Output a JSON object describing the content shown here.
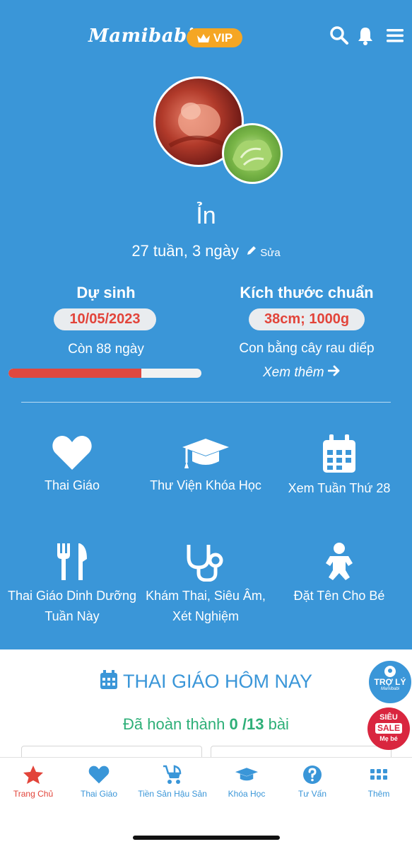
{
  "header": {
    "brand": "Mamibabi",
    "vip_label": "VIP"
  },
  "profile": {
    "name": "Ỉn",
    "gestational_age": "27 tuần, 3 ngày",
    "edit_label": "Sửa"
  },
  "due": {
    "title": "Dự sinh",
    "date": "10/05/2023",
    "remaining": "Còn 88 ngày",
    "progress": 0.69
  },
  "size": {
    "title": "Kích thước chuẩn",
    "value": "38cm; 1000g",
    "compare": "Con bằng cây rau diếp",
    "more": "Xem thêm"
  },
  "features": [
    {
      "label": "Thai Giáo",
      "icon": "heart-icon"
    },
    {
      "label": "Thư Viện Khóa Học",
      "icon": "graduation-cap-icon"
    },
    {
      "label": "Xem Tuần Thứ 28",
      "icon": "calendar-icon"
    },
    {
      "label": "Thai Giáo Dinh Dưỡng Tuần Này",
      "icon": "utensils-icon"
    },
    {
      "label": "Khám Thai, Siêu Âm, Xét Nghiệm",
      "icon": "stethoscope-icon"
    },
    {
      "label": "Đặt Tên Cho Bé",
      "icon": "baby-icon"
    }
  ],
  "today": {
    "title": "THAI GIÁO HÔM NAY",
    "done_prefix": "Đã hoàn thành",
    "done_count": "0 /13",
    "done_suffix": "bài"
  },
  "fabs": {
    "assistant_line1": "TRỢ LÝ",
    "assistant_line2": "Mamibabi",
    "sale_line1": "SIÊU",
    "sale_line2": "SALE",
    "sale_line3": "Mẹ bé"
  },
  "tabs": [
    {
      "label": "Trang Chủ",
      "icon": "star-icon",
      "active": true
    },
    {
      "label": "Thai Giáo",
      "icon": "heart-icon"
    },
    {
      "label": "Tiền Sản Hậu Sản",
      "icon": "stroller-icon"
    },
    {
      "label": "Khóa Học",
      "icon": "graduation-cap-icon"
    },
    {
      "label": "Tư Vấn",
      "icon": "question-icon"
    },
    {
      "label": "Thêm",
      "icon": "grid-icon"
    }
  ],
  "colors": {
    "primary": "#3a96d8",
    "accent": "#e2443a",
    "vip": "#f5a623",
    "success": "#2eaf78"
  }
}
